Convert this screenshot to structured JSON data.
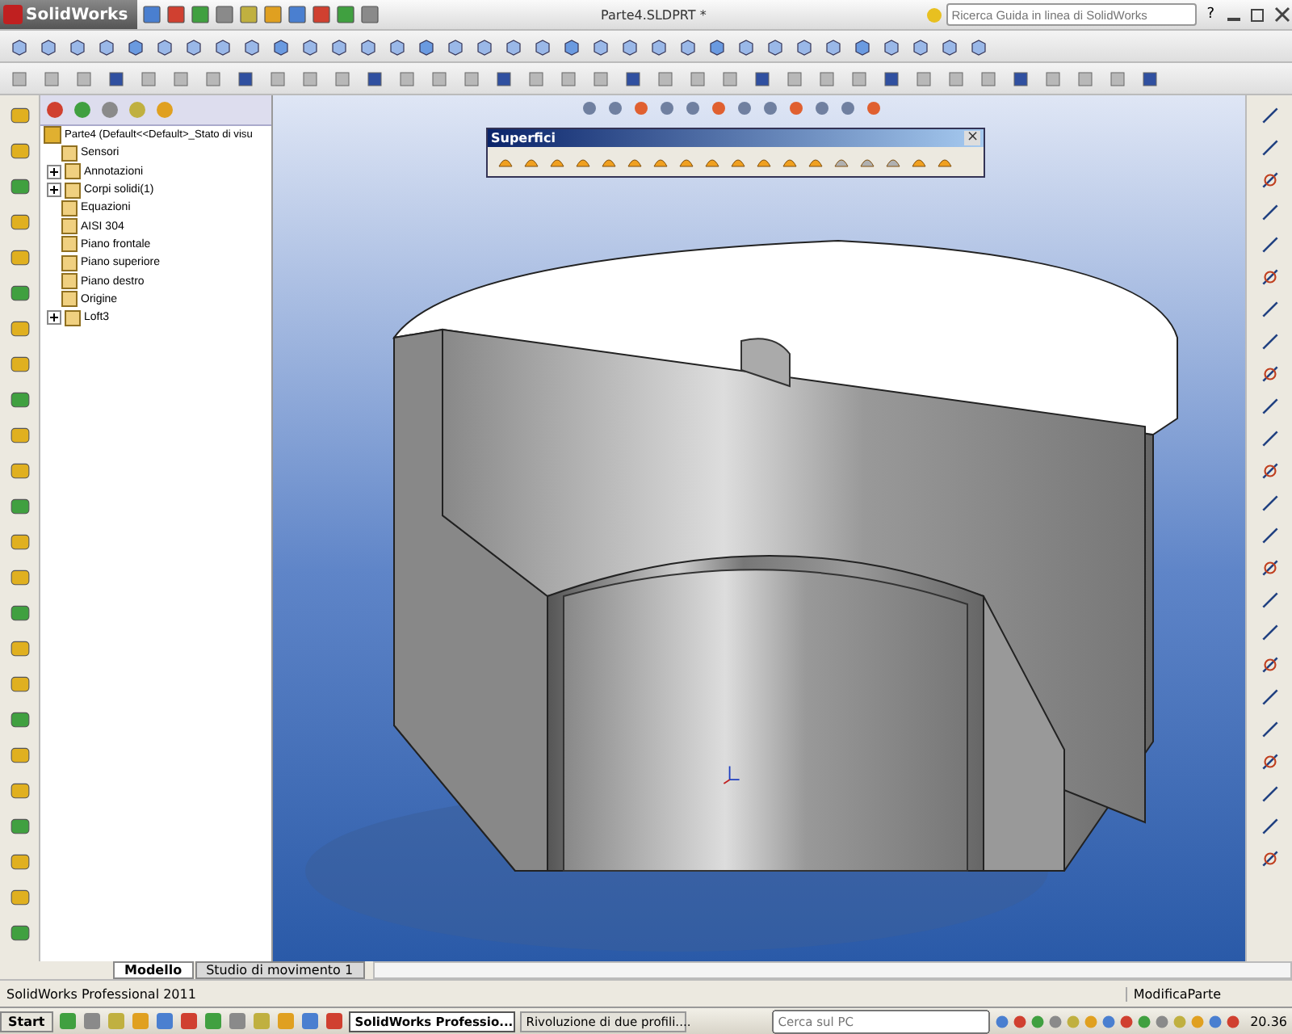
{
  "app": {
    "logo": "SolidWorks",
    "title": "Parte4.SLDPRT *",
    "search_placeholder": "Ricerca Guida in linea di SolidWorks",
    "help": "?"
  },
  "tree": {
    "root": "Parte4  (Default<<Default>_Stato di visu",
    "items": [
      {
        "label": "Sensori",
        "expander": false
      },
      {
        "label": "Annotazioni",
        "expander": true
      },
      {
        "label": "Corpi solidi(1)",
        "expander": true
      },
      {
        "label": "Equazioni",
        "expander": false
      },
      {
        "label": "AISI 304",
        "expander": false
      },
      {
        "label": "Piano frontale",
        "expander": false
      },
      {
        "label": "Piano superiore",
        "expander": false
      },
      {
        "label": "Piano destro",
        "expander": false
      },
      {
        "label": "Origine",
        "expander": false
      },
      {
        "label": "Loft3",
        "expander": true
      }
    ]
  },
  "floating_toolbar": {
    "title": "Superfici",
    "close": "×"
  },
  "bottom_tabs": [
    {
      "label": "Modello",
      "selected": true
    },
    {
      "label": "Studio di movimento 1",
      "selected": false
    }
  ],
  "status_bar": {
    "product": "SolidWorks Professional 2011",
    "mode": "ModificaParte"
  },
  "taskbar": {
    "start": "Start",
    "tasks": [
      {
        "label": "SolidWorks Professio...",
        "selected": true
      },
      {
        "label": "Rivoluzione di due profili....",
        "selected": false
      }
    ],
    "search_placeholder": "Cerca sul PC",
    "clock": "20.36"
  }
}
